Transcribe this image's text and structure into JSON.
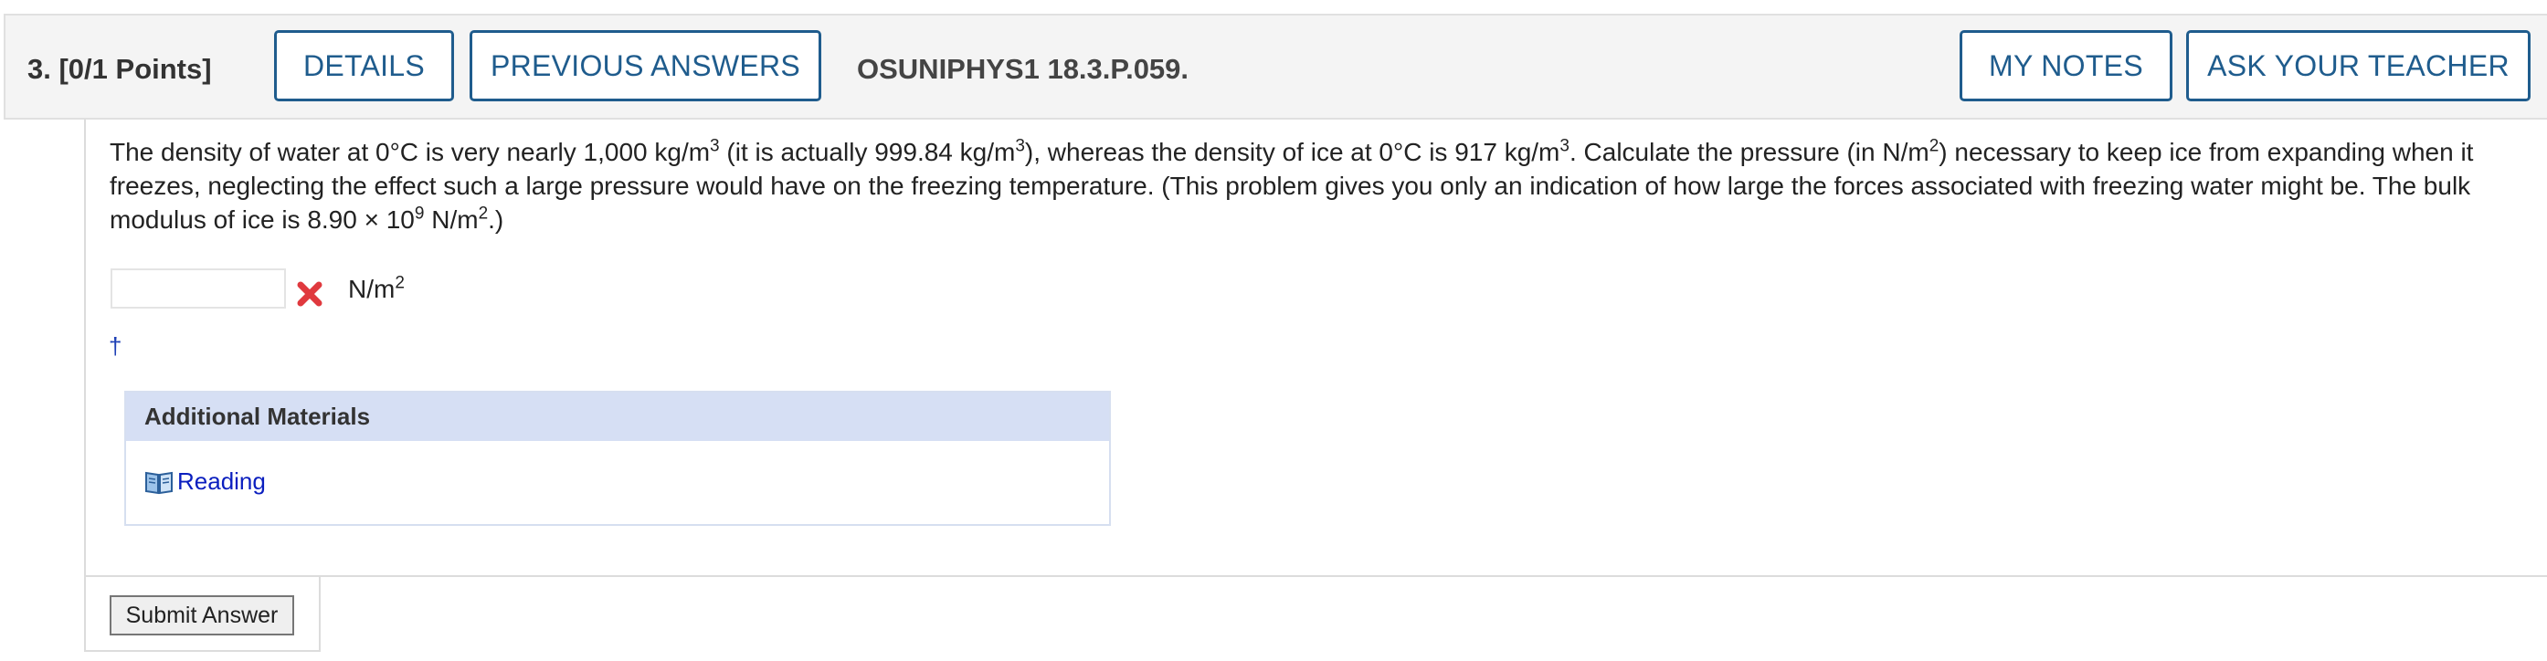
{
  "header": {
    "question_number": "3.",
    "points": "[0/1 Points]",
    "details_label": "DETAILS",
    "previous_answers_label": "PREVIOUS ANSWERS",
    "problem_code": "OSUNIPHYS1 18.3.P.059.",
    "my_notes_label": "MY NOTES",
    "ask_teacher_label": "ASK YOUR TEACHER"
  },
  "question": {
    "t1": "The density of water at 0°C is very nearly 1,000 kg/m",
    "s1": "3",
    "t2": " (it is actually 999.84 kg/m",
    "s2": "3",
    "t3": "), whereas the density of ice at 0°C is 917 kg/m",
    "s3": "3",
    "t4": ". Calculate the pressure (in N/m",
    "s4": "2",
    "t5": ") necessary to keep ice from expanding when it freezes, neglecting the effect such a large pressure would have on the freezing temperature. (This problem gives you only an indication of how large the forces associated with freezing water might be. The bulk modulus of ice is 8.90 × 10",
    "s5": "9",
    "t6": " N/m",
    "s6": "2",
    "t7": ".)"
  },
  "answer": {
    "value": "",
    "unit": "N/m",
    "unit_exp": "2",
    "status": "incorrect"
  },
  "dagger": "†",
  "materials": {
    "title": "Additional Materials",
    "reading_label": "Reading"
  },
  "submit_label": "Submit Answer",
  "colors": {
    "accent": "#1f5c8d",
    "incorrect": "#e0393e",
    "link": "#0b1fbf",
    "materials_header": "#d6dff4"
  },
  "icons": {
    "incorrect": "x-mark-icon",
    "reading": "book-icon"
  }
}
